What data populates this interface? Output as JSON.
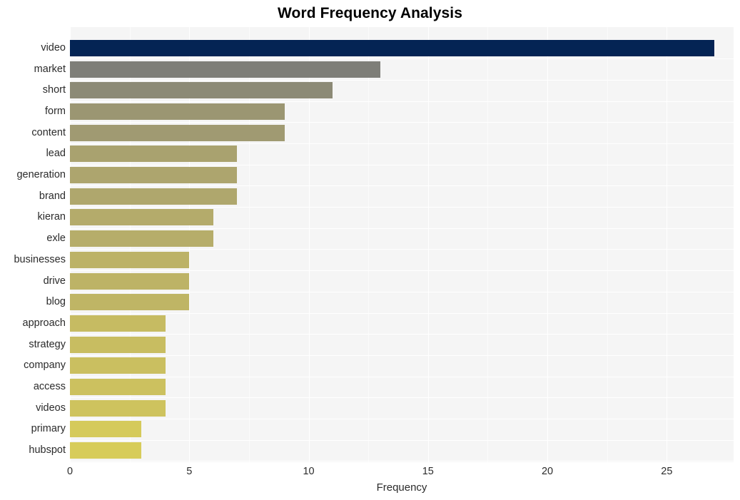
{
  "chart_data": {
    "type": "bar",
    "orientation": "horizontal",
    "title": "Word Frequency Analysis",
    "xlabel": "Frequency",
    "ylabel": "",
    "xlim": [
      0,
      27.8
    ],
    "xticks": [
      0,
      5,
      10,
      15,
      20,
      25
    ],
    "xticklabels": [
      "0",
      "5",
      "10",
      "15",
      "20",
      "25"
    ],
    "grid": true,
    "grid_axis": "both",
    "grid_color": "#ffffff",
    "panel_background": "#f5f5f5",
    "figure_background": "#ffffff",
    "legend": null,
    "categories": [
      "video",
      "market",
      "short",
      "form",
      "content",
      "lead",
      "generation",
      "brand",
      "kieran",
      "exle",
      "businesses",
      "drive",
      "blog",
      "approach",
      "strategy",
      "company",
      "access",
      "videos",
      "primary",
      "hubspot"
    ],
    "values": [
      27,
      13,
      11,
      9,
      9,
      7,
      7,
      7,
      6,
      6,
      5,
      5,
      5,
      4,
      4,
      4,
      4,
      4,
      3,
      3
    ],
    "bar_colors": [
      "#042454",
      "#7e7e78",
      "#8c8a76",
      "#9b9672",
      "#a09a72",
      "#a9a26f",
      "#ada56e",
      "#afa76d",
      "#b4ab6b",
      "#b6ad6a",
      "#bcb267",
      "#bdb366",
      "#bfb565",
      "#c6bb62",
      "#c8bd61",
      "#cabf60",
      "#ccc15f",
      "#cec35e",
      "#d5ca5b",
      "#d7cc5a"
    ]
  }
}
